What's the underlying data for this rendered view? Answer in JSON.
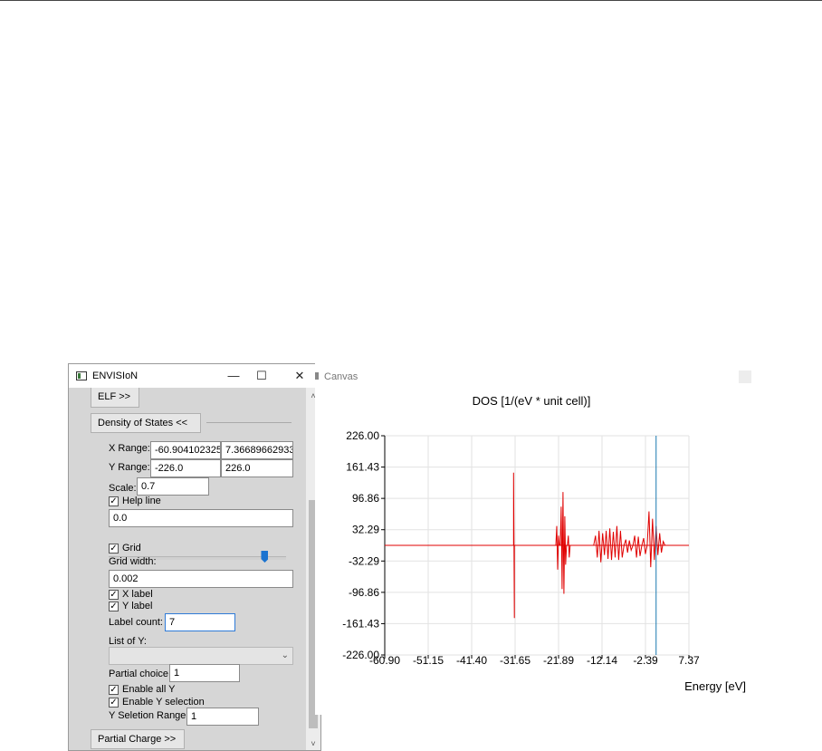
{
  "window": {
    "title": "ENVISIoN",
    "minimize_glyph": "—",
    "maximize_glyph": "☐",
    "close_glyph": "✕"
  },
  "panel": {
    "elf_button": "ELF >>",
    "dos_button": "Density of States <<",
    "x_range_label": "X Range:",
    "x_range_min": "-60.904102325",
    "x_range_max": "7.36689662933",
    "y_range_label": "Y Range:",
    "y_range_min": "-226.0",
    "y_range_max": "226.0",
    "scale_label": "Scale:",
    "scale_value": "0.7",
    "help_line_label": "Help line",
    "help_line_checked": true,
    "help_line_value": "0.0",
    "help_line_slider_fraction": 0.88,
    "grid_label": "Grid",
    "grid_checked": true,
    "grid_width_label": "Grid width:",
    "grid_width_value": "0.002",
    "x_label_label": "X label",
    "x_label_checked": true,
    "y_label_label": "Y label",
    "y_label_checked": true,
    "label_count_label": "Label count:",
    "label_count_value": "7",
    "list_of_y_label": "List of Y:",
    "list_of_y_value": "",
    "partial_choice_label": "Partial choice:",
    "partial_choice_value": "1",
    "enable_all_y_label": "Enable all Y",
    "enable_all_y_checked": true,
    "enable_y_selection_label": "Enable Y selection",
    "enable_y_selection_checked": true,
    "y_selection_range_label": "Y Seletion Range:",
    "y_selection_range_value": "1",
    "partial_charge_button": "Partial Charge >>"
  },
  "canvas": {
    "window_title": "Canvas"
  },
  "chart_data": {
    "type": "line",
    "title": "DOS [1/(eV * unit cell)]",
    "xlabel": "Energy [eV]",
    "ylabel": "",
    "xlim": [
      -60.904102325,
      7.36689662933
    ],
    "ylim": [
      -226.0,
      226.0
    ],
    "x_ticks": [
      "-60.90",
      "-51.15",
      "-41.40",
      "-31.65",
      "-21.89",
      "-12.14",
      "-2.39",
      "7.37"
    ],
    "y_ticks": [
      "226.00",
      "161.43",
      "96.86",
      "32.29",
      "-32.29",
      "-96.86",
      "-161.43",
      "-226.00"
    ],
    "grid": true,
    "help_line_x": 0.0,
    "colors": {
      "dos": "#e00000",
      "help_line": "#1a7ab0",
      "grid": "#e2e2e2"
    },
    "series": [
      {
        "x": [
          -32.0,
          -32.0,
          -31.8,
          -31.8,
          -22.5,
          -22.3,
          -22.1,
          -21.9,
          -21.7,
          -21.5,
          -21.3,
          -21.1,
          -20.9,
          -20.7,
          -20.5,
          -20.3,
          -20.1,
          -19.9,
          -19.7,
          -19.5,
          -19.3,
          -19.1,
          -18.9,
          -18.7,
          -14.0,
          -13.6,
          -13.2,
          -12.8,
          -12.4,
          -12.0,
          -11.6,
          -11.2,
          -10.8,
          -10.4,
          -10.0,
          -9.6,
          -9.2,
          -8.8,
          -8.4,
          -8.0,
          -7.6,
          -7.2,
          -6.8,
          -6.4,
          -6.0,
          -5.6,
          -5.2,
          -4.8,
          -4.4,
          -4.0,
          -3.6,
          -3.2,
          -2.8,
          -2.4,
          -2.0,
          -1.6,
          -1.2,
          -0.8,
          -0.4,
          0.0,
          0.4,
          0.8,
          1.2,
          1.6,
          2.0
        ],
        "y": [
          0,
          150,
          -150,
          0,
          0,
          40,
          -50,
          20,
          0,
          0,
          80,
          -90,
          110,
          -100,
          60,
          -40,
          0,
          0,
          20,
          -25,
          0,
          0,
          0,
          0,
          0,
          20,
          -25,
          30,
          -35,
          25,
          -20,
          30,
          -28,
          35,
          -30,
          28,
          -25,
          40,
          -30,
          30,
          -25,
          0,
          12,
          -15,
          10,
          -10,
          0,
          20,
          -25,
          18,
          -22,
          0,
          15,
          -18,
          0,
          70,
          -45,
          55,
          -30,
          40,
          -20,
          25,
          -15,
          8,
          0
        ]
      }
    ]
  }
}
